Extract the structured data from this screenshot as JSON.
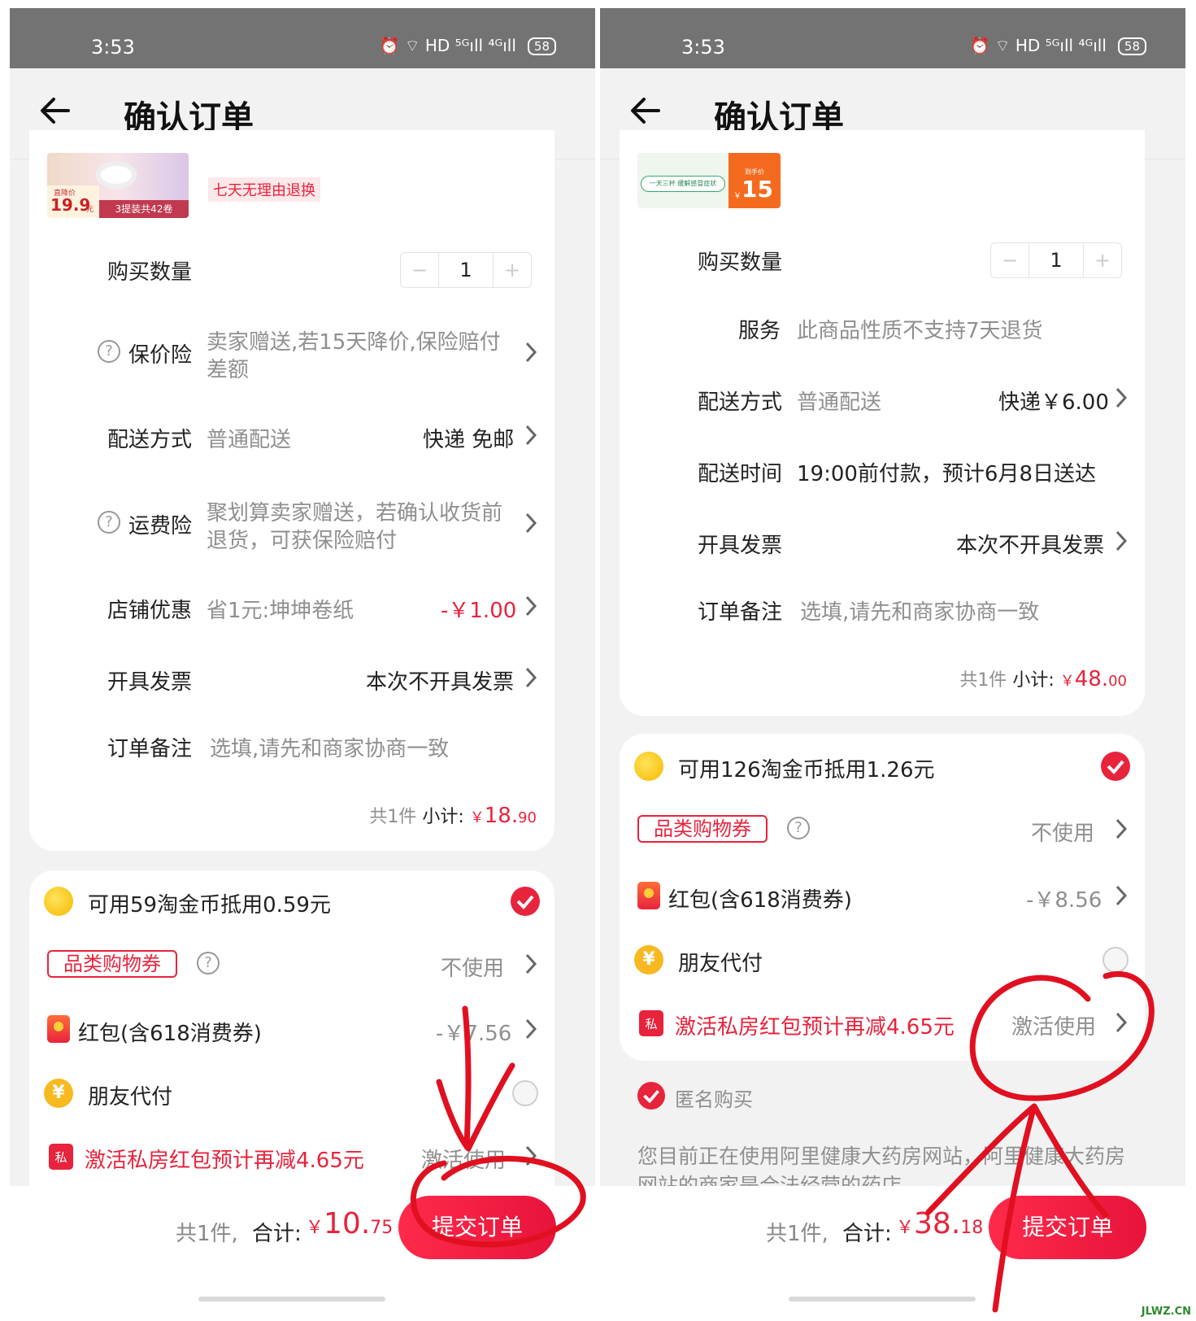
{
  "left": {
    "status": {
      "time": "3:53",
      "icons": "⏰ ⌔ HD ⁵ᴳıll ⁴ᴳıll",
      "battery": "58"
    },
    "nav": {
      "title": "确认订单"
    },
    "product": {
      "badge_price_label": "直降价",
      "badge_price": "19.9",
      "badge_unit": "元",
      "badge_pack": "3提装共42卷",
      "return_tag": "七天无理由退换"
    },
    "quantity": {
      "label": "购买数量",
      "minus": "−",
      "value": "1",
      "plus": "+"
    },
    "price_insurance": {
      "label": "保价险",
      "value_line1": "卖家赠送,若15天降价,保险赔付",
      "value_line2": "差额"
    },
    "delivery": {
      "label": "配送方式",
      "value": "普通配送",
      "right": "快递 免邮"
    },
    "freight_insurance": {
      "label": "运费险",
      "value_line1": "聚划算卖家赠送，若确认收货前",
      "value_line2": "退货，可获保险赔付"
    },
    "shop_discount": {
      "label": "店铺优惠",
      "value": "省1元:坤坤卷纸",
      "right": "-￥1.00"
    },
    "invoice": {
      "label": "开具发票",
      "right": "本次不开具发票"
    },
    "remark": {
      "label": "订单备注",
      "placeholder": "选填,请先和商家协商一致"
    },
    "subtotal": {
      "count": "共1件",
      "label": "小计:",
      "symbol": "￥",
      "int": "18.",
      "dec": "90"
    },
    "coins": {
      "text": "可用59淘金币抵用0.59元"
    },
    "coupon": {
      "tag": "品类购物券",
      "help": "?",
      "right": "不使用"
    },
    "redpacket": {
      "label": "红包(含618消费券)",
      "right": "-￥7.56"
    },
    "friend_pay": {
      "label": "朋友代付"
    },
    "activate": {
      "icon_text": "私",
      "text": "激活私房红包预计再减4.65元",
      "right": "激活使用"
    },
    "bottom": {
      "count": "共1件,",
      "total_label": "合计:",
      "symbol": "￥",
      "int": "10.",
      "dec": "75",
      "submit": "提交订单"
    }
  },
  "right": {
    "status": {
      "time": "3:53",
      "icons": "⏰ ⌔ HD ⁵ᴳıll ⁴ᴳıll",
      "battery": "58"
    },
    "nav": {
      "title": "确认订单"
    },
    "product": {
      "badge_small": "到手价",
      "badge_price": "15",
      "badge_symbol": "￥",
      "strip_text": "一天三杯 缓解感冒症状"
    },
    "quantity": {
      "label": "购买数量",
      "minus": "−",
      "value": "1",
      "plus": "+"
    },
    "service": {
      "label": "服务",
      "value": "此商品性质不支持7天退货"
    },
    "delivery": {
      "label": "配送方式",
      "value": "普通配送",
      "right": "快递￥6.00"
    },
    "delivery_time": {
      "label": "配送时间",
      "value": "19:00前付款，预计6月8日送达"
    },
    "invoice": {
      "label": "开具发票",
      "right": "本次不开具发票"
    },
    "remark": {
      "label": "订单备注",
      "placeholder": "选填,请先和商家协商一致"
    },
    "subtotal": {
      "count": "共1件",
      "label": "小计:",
      "symbol": "￥",
      "int": "48.",
      "dec": "00"
    },
    "coins": {
      "text": "可用126淘金币抵用1.26元"
    },
    "coupon": {
      "tag": "品类购物券",
      "help": "?",
      "right": "不使用"
    },
    "redpacket": {
      "label": "红包(含618消费券)",
      "right": "-￥8.56"
    },
    "friend_pay": {
      "label": "朋友代付"
    },
    "activate": {
      "icon_text": "私",
      "text": "激活私房红包预计再减4.65元",
      "right": "激活使用"
    },
    "anonymous": {
      "label": "匿名购买"
    },
    "notice": {
      "line1": "您目前正在使用阿里健康大药房网站，阿里健康大药房",
      "line2": "网站的商家是合法经营的药店"
    },
    "bottom": {
      "count": "共1件,",
      "total_label": "合计:",
      "symbol": "￥",
      "int": "38.",
      "dec": "18",
      "submit": "提交订单"
    }
  },
  "watermark": "JLWZ.CN",
  "colors": {
    "accent": "#e8233c",
    "statusbar": "#737373",
    "annotation": "#e01020"
  }
}
